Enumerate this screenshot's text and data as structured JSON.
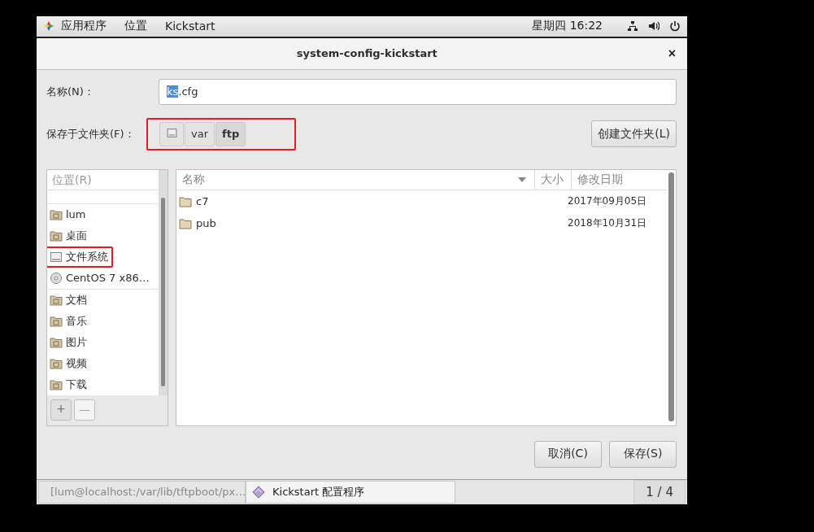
{
  "top_bar": {
    "menus": [
      "应用程序",
      "位置",
      "Kickstart"
    ],
    "clock": "星期四 16:22"
  },
  "dialog": {
    "title": "system-config-kickstart",
    "close": "×",
    "name_field": {
      "label": "名称(N)：",
      "value_selected": "ks",
      "value_rest": ".cfg"
    },
    "folder": {
      "label": "保存于文件夹(F)：",
      "highlighted": true,
      "path": [
        {
          "kind": "drive",
          "selected": false
        },
        {
          "kind": "text",
          "label": "var",
          "selected": false
        },
        {
          "kind": "text",
          "label": "ftp",
          "selected": true
        }
      ],
      "create_button": "创建文件夹(L)"
    },
    "places": {
      "header": "位置(R)",
      "items": [
        {
          "kind": "home",
          "label": "lum",
          "highlighted": false,
          "group_end": false
        },
        {
          "kind": "desktop",
          "label": "桌面",
          "highlighted": false,
          "group_end": false
        },
        {
          "kind": "drive",
          "label": "文件系统",
          "highlighted": true,
          "group_end": false
        },
        {
          "kind": "disc",
          "label": "CentOS 7 x86…",
          "highlighted": false,
          "group_end": true
        },
        {
          "kind": "documents",
          "label": "文档",
          "highlighted": false,
          "group_end": false
        },
        {
          "kind": "music",
          "label": "音乐",
          "highlighted": false,
          "group_end": false
        },
        {
          "kind": "pictures",
          "label": "图片",
          "highlighted": false,
          "group_end": false
        },
        {
          "kind": "videos",
          "label": "视频",
          "highlighted": false,
          "group_end": false
        },
        {
          "kind": "downloads",
          "label": "下载",
          "highlighted": false,
          "group_end": false
        }
      ],
      "add": "+",
      "remove": "—"
    },
    "files": {
      "columns": [
        "名称",
        "大小",
        "修改日期"
      ],
      "rows": [
        {
          "name": "c7",
          "modified": "2017年09月05日"
        },
        {
          "name": "pub",
          "modified": "2018年10月31日"
        }
      ]
    },
    "buttons": [
      "取消(C)",
      "保存(S)"
    ]
  },
  "taskbar": {
    "items": [
      {
        "kind": "terminal",
        "label": "[lum@localhost:/var/lib/tftpboot/px…",
        "selected": false
      },
      {
        "kind": "app",
        "label": "Kickstart 配置程序",
        "selected": true
      }
    ],
    "workspace": "1 / 4"
  }
}
